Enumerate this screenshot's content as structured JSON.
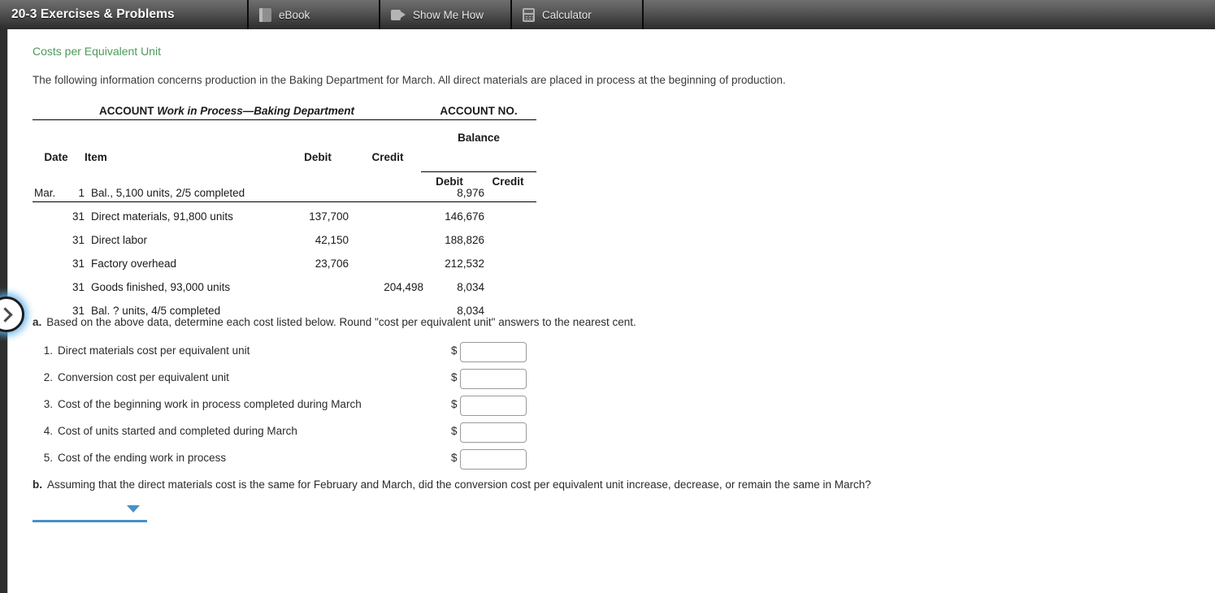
{
  "header": {
    "title": "20-3 Exercises & Problems",
    "tabs": [
      {
        "label": "eBook",
        "icon": "book-icon"
      },
      {
        "label": "Show Me How",
        "icon": "video-icon"
      },
      {
        "label": "Calculator",
        "icon": "calculator-icon"
      }
    ]
  },
  "page": {
    "section_title": "Costs per Equivalent Unit",
    "intro": "The following information concerns production in the Baking Department for March. All direct materials are placed in process at the beginning of production.",
    "accent_color": "#4c9a5a",
    "dropdown_color": "#4a8fc4"
  },
  "ledger": {
    "account_label": "ACCOUNT",
    "account_name": "Work in Process—Baking Department",
    "account_no_label": "ACCOUNT NO.",
    "account_no_value": "",
    "balance_group": "Balance",
    "columns": {
      "date": "Date",
      "item": "Item",
      "debit": "Debit",
      "credit": "Credit",
      "balance_debit": "Debit",
      "balance_credit": "Credit"
    },
    "rows": [
      {
        "month": "Mar.",
        "day": "1",
        "item": "Bal., 5,100 units, 2/5 completed",
        "debit": "",
        "credit": "",
        "bal_debit": "8,976",
        "bal_credit": ""
      },
      {
        "month": "",
        "day": "31",
        "item": "Direct materials, 91,800 units",
        "debit": "137,700",
        "credit": "",
        "bal_debit": "146,676",
        "bal_credit": ""
      },
      {
        "month": "",
        "day": "31",
        "item": "Direct labor",
        "debit": "42,150",
        "credit": "",
        "bal_debit": "188,826",
        "bal_credit": ""
      },
      {
        "month": "",
        "day": "31",
        "item": "Factory overhead",
        "debit": "23,706",
        "credit": "",
        "bal_debit": "212,532",
        "bal_credit": ""
      },
      {
        "month": "",
        "day": "31",
        "item": "Goods finished, 93,000 units",
        "debit": "",
        "credit": "204,498",
        "bal_debit": "8,034",
        "bal_credit": ""
      },
      {
        "month": "",
        "day": "31",
        "item": "Bal. ? units, 4/5 completed",
        "debit": "",
        "credit": "",
        "bal_debit": "8,034",
        "bal_credit": ""
      }
    ]
  },
  "question_a": {
    "label": "a.",
    "text": "Based on the above data, determine each cost listed below. Round \"cost per equivalent unit\" answers to the nearest cent.",
    "currency_symbol": "$",
    "items": [
      {
        "num": "1.",
        "text": "Direct materials cost per equivalent unit",
        "value": "",
        "placeholder": ""
      },
      {
        "num": "2.",
        "text": "Conversion cost per equivalent unit",
        "value": "",
        "placeholder": ""
      },
      {
        "num": "3.",
        "text": "Cost of the beginning work in process completed during March",
        "value": "",
        "placeholder": ""
      },
      {
        "num": "4.",
        "text": "Cost of units started and completed during March",
        "value": "",
        "placeholder": ""
      },
      {
        "num": "5.",
        "text": "Cost of the ending work in process",
        "value": "",
        "placeholder": ""
      }
    ]
  },
  "question_b": {
    "label": "b.",
    "text": "Assuming that the direct materials cost is the same for February and March, did the conversion cost per equivalent unit increase, decrease, or remain the same in March?",
    "dropdown_value": ""
  },
  "slide_button": {
    "icon": "chevron-right-icon"
  }
}
